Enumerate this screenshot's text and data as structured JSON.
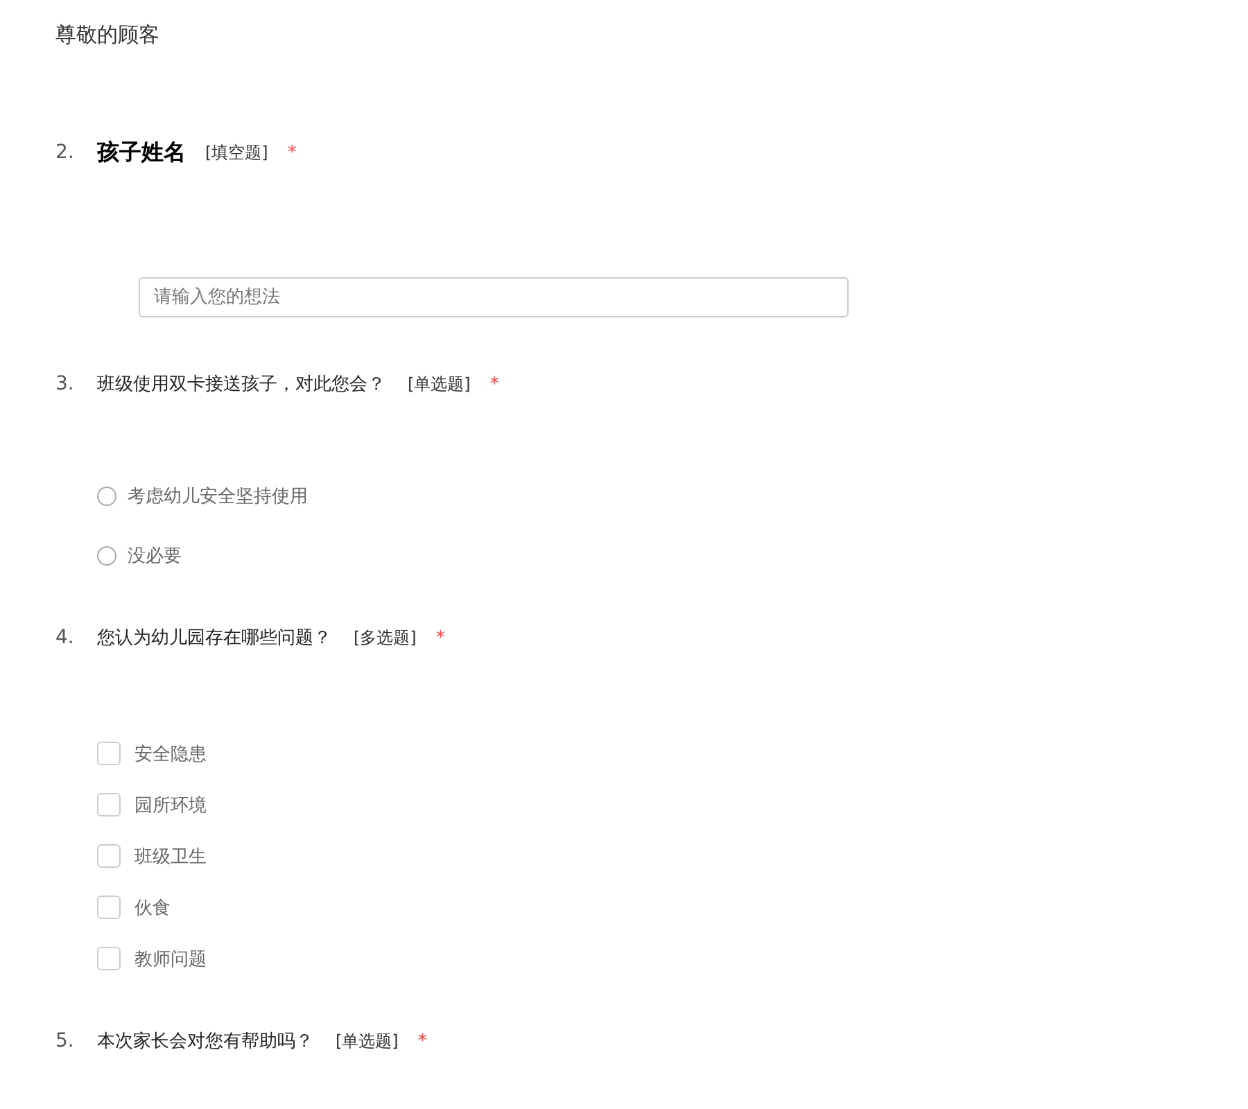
{
  "greeting": "尊敬的顾客",
  "questions": [
    {
      "number": "2.",
      "title": "孩子姓名",
      "type_label": "[填空题]",
      "required_mark": "*",
      "kind": "text",
      "emphasized": true,
      "placeholder": "请输入您的想法"
    },
    {
      "number": "3.",
      "title": "班级使用双卡接送孩子，对此您会？",
      "type_label": "[单选题]",
      "required_mark": "*",
      "kind": "single",
      "emphasized": false,
      "options": [
        {
          "label": "考虑幼儿安全坚持使用",
          "selected": false
        },
        {
          "label": "没必要",
          "selected": false
        }
      ]
    },
    {
      "number": "4.",
      "title": "您认为幼儿园存在哪些问题？",
      "type_label": "[多选题]",
      "required_mark": "*",
      "kind": "multiple",
      "emphasized": false,
      "options": [
        {
          "label": "安全隐患",
          "checked": false
        },
        {
          "label": "园所环境",
          "checked": false
        },
        {
          "label": "班级卫生",
          "checked": false
        },
        {
          "label": "伙食",
          "checked": false
        },
        {
          "label": "教师问题",
          "checked": false
        }
      ]
    },
    {
      "number": "5.",
      "title": "本次家长会对您有帮助吗？",
      "type_label": "[单选题]",
      "required_mark": "*",
      "kind": "single",
      "emphasized": false
    }
  ]
}
